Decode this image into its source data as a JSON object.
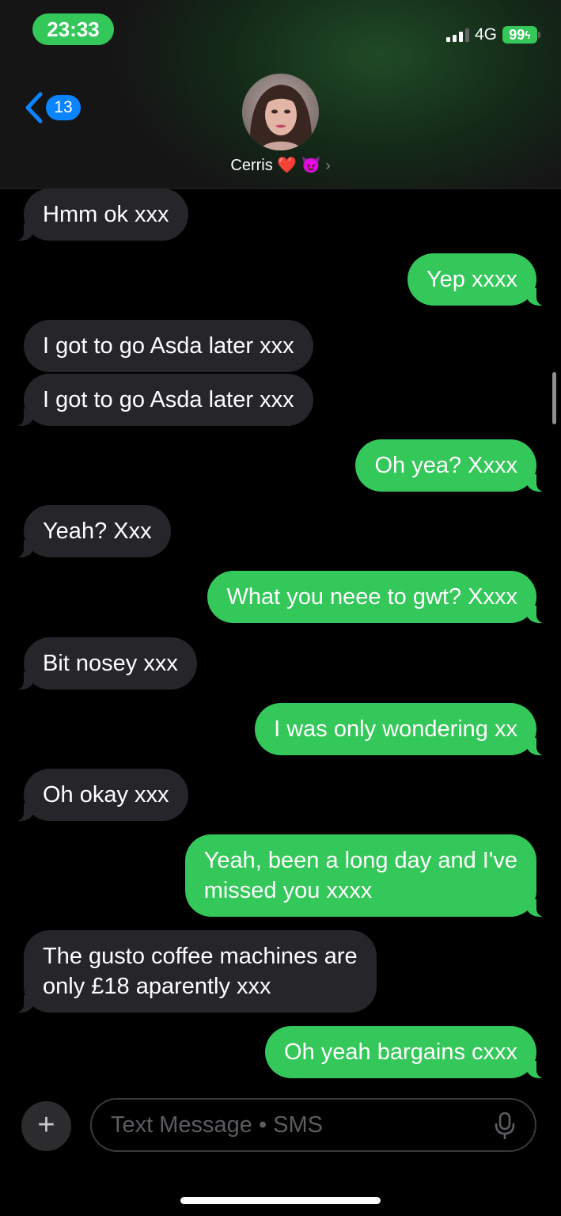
{
  "status_bar": {
    "time": "23:33",
    "network": "4G",
    "battery": "99",
    "signal_bars_filled": 3,
    "signal_bars_total": 4
  },
  "header": {
    "back_count": "13",
    "contact_name": "Cerris ❤️ 😈",
    "contact_chevron": "›"
  },
  "messages": [
    {
      "direction": "in",
      "text": "Hmm ok xxx"
    },
    {
      "direction": "out",
      "text": "Yep xxxx"
    },
    {
      "direction": "in",
      "text": "I got to go Asda later xxx"
    },
    {
      "direction": "in",
      "text": "I got to go Asda later xxx"
    },
    {
      "direction": "out",
      "text": "Oh yea? Xxxx"
    },
    {
      "direction": "in",
      "text": "Yeah? Xxx"
    },
    {
      "direction": "out",
      "text": "What you neee to gwt? Xxxx"
    },
    {
      "direction": "in",
      "text": "Bit nosey xxx"
    },
    {
      "direction": "out",
      "text": "I was only wondering xx"
    },
    {
      "direction": "in",
      "text": "Oh okay xxx"
    },
    {
      "direction": "out",
      "text": "Yeah, been a long day and I've\nmissed you xxxx"
    },
    {
      "direction": "in",
      "text": "The gusto coffee machines are\nonly £18 aparently xxx"
    },
    {
      "direction": "out",
      "text": "Oh yeah bargains cxxx"
    }
  ],
  "composer": {
    "placeholder": "Text Message • SMS",
    "add_label": "+"
  },
  "colors": {
    "accent_green": "#34c759",
    "incoming_bubble": "#26252a",
    "link_blue": "#0a84ff"
  }
}
